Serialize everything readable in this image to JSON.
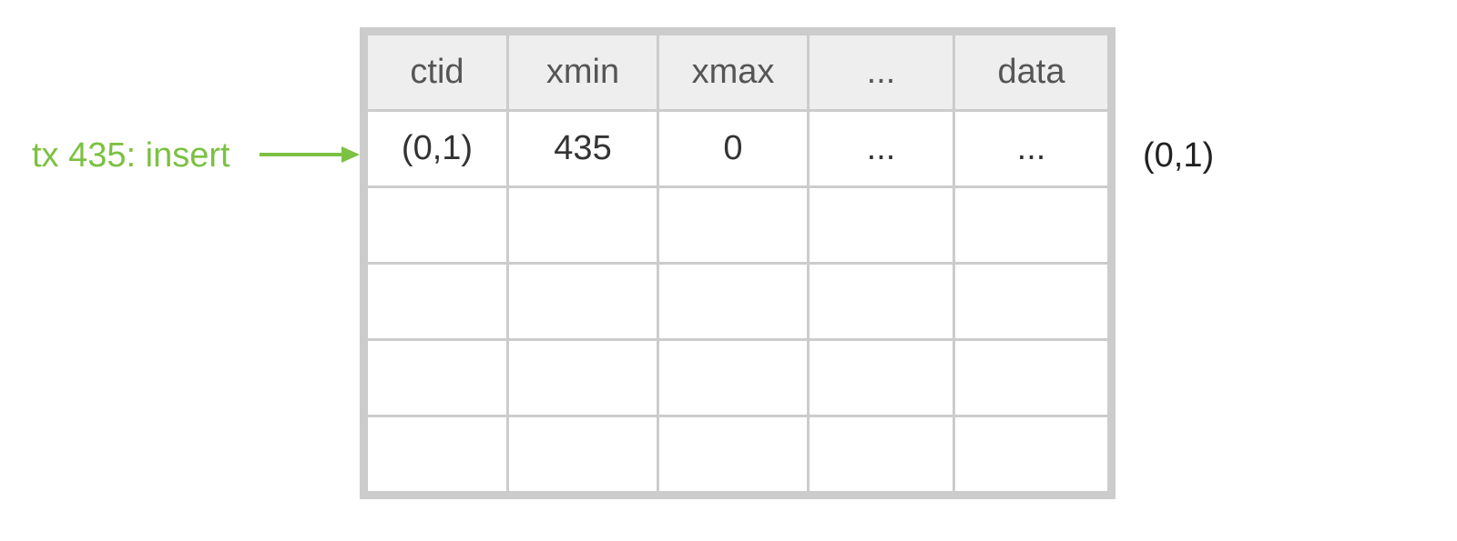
{
  "annotation": {
    "label": "tx 435: insert",
    "color": "#7cc142"
  },
  "table": {
    "headers": [
      "ctid",
      "xmin",
      "xmax",
      "...",
      "data"
    ],
    "rows": [
      {
        "ctid": "(0,1)",
        "xmin": "435",
        "xmax": "0",
        "dots": "...",
        "data": "..."
      },
      {
        "ctid": "",
        "xmin": "",
        "xmax": "",
        "dots": "",
        "data": ""
      },
      {
        "ctid": "",
        "xmin": "",
        "xmax": "",
        "dots": "",
        "data": ""
      },
      {
        "ctid": "",
        "xmin": "",
        "xmax": "",
        "dots": "",
        "data": ""
      },
      {
        "ctid": "",
        "xmin": "",
        "xmax": "",
        "dots": "",
        "data": ""
      }
    ]
  },
  "row_label": "(0,1)"
}
